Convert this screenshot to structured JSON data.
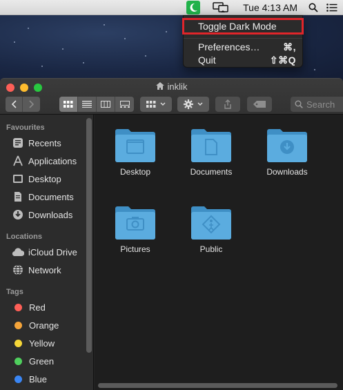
{
  "menubar": {
    "time": "Tue 4:13 AM"
  },
  "app_menu": {
    "items": [
      {
        "label": "Toggle Dark Mode",
        "shortcut": ""
      },
      {
        "label": "Preferences…",
        "shortcut": "⌘,"
      },
      {
        "label": "Quit",
        "shortcut": "⇧⌘Q"
      }
    ]
  },
  "window": {
    "title": "inklik",
    "search_placeholder": "Search"
  },
  "sidebar": {
    "favourites_heading": "Favourites",
    "favourites": [
      {
        "label": "Recents",
        "icon": "clock-icon"
      },
      {
        "label": "Applications",
        "icon": "applications-icon"
      },
      {
        "label": "Desktop",
        "icon": "desktop-icon"
      },
      {
        "label": "Documents",
        "icon": "document-icon"
      },
      {
        "label": "Downloads",
        "icon": "download-icon"
      }
    ],
    "locations_heading": "Locations",
    "locations": [
      {
        "label": "iCloud Drive",
        "icon": "cloud-icon"
      },
      {
        "label": "Network",
        "icon": "globe-icon"
      }
    ],
    "tags_heading": "Tags",
    "tags": [
      {
        "label": "Red",
        "color": "#fe5f57"
      },
      {
        "label": "Orange",
        "color": "#f4a43a"
      },
      {
        "label": "Yellow",
        "color": "#f5d638"
      },
      {
        "label": "Green",
        "color": "#4fcf5d"
      },
      {
        "label": "Blue",
        "color": "#3a86f4"
      }
    ]
  },
  "folders": [
    {
      "label": "Desktop",
      "glyph": "desktop"
    },
    {
      "label": "Documents",
      "glyph": "document"
    },
    {
      "label": "Downloads",
      "glyph": "download"
    },
    {
      "label": "Pictures",
      "glyph": "camera"
    },
    {
      "label": "Public",
      "glyph": "public"
    }
  ]
}
